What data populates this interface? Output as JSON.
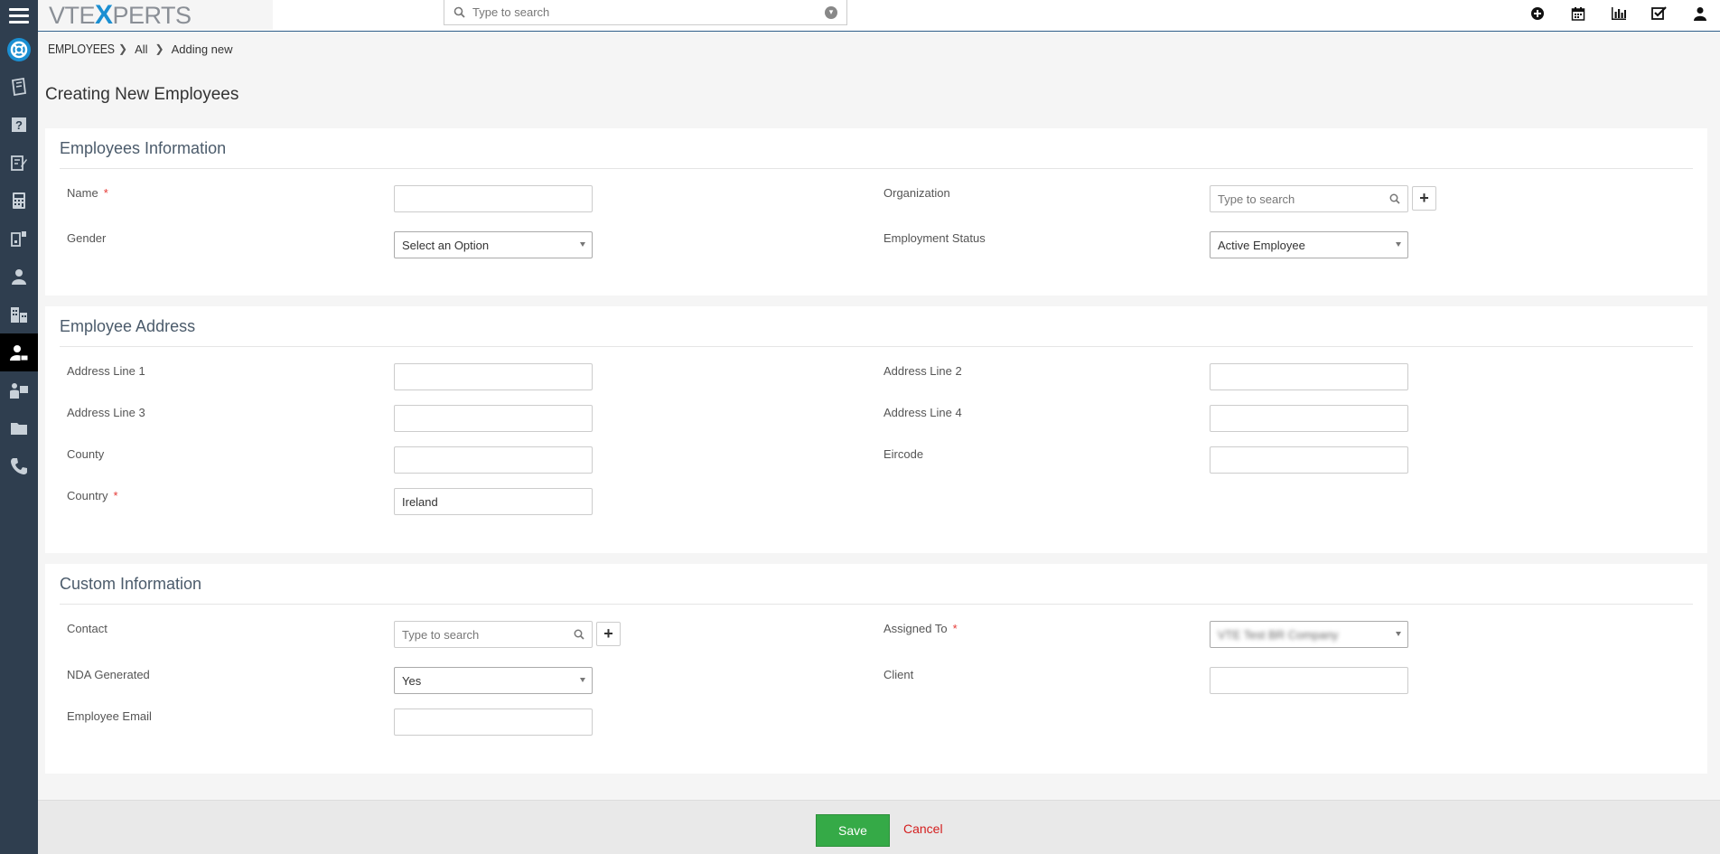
{
  "app": {
    "logo_pre": "VTE",
    "logo_x": "X",
    "logo_post": "PERTS"
  },
  "search": {
    "placeholder": "Type to search"
  },
  "top_icons": [
    "plus-circle-icon",
    "calendar-icon",
    "bar-chart-icon",
    "checkbox-icon",
    "user-icon"
  ],
  "sidebar": {
    "items": [
      "lifesaver-icon",
      "tickets-icon",
      "faq-icon",
      "edit-icon",
      "calculator-icon",
      "projects-icon",
      "contact-icon",
      "organizations-icon",
      "employees-icon",
      "vendors-icon",
      "documents-icon",
      "phone-icon"
    ],
    "active_index": 8
  },
  "breadcrumb": {
    "module": "EMPLOYEES",
    "level1": "All",
    "level2": "Adding new"
  },
  "page_title": "Creating New Employees",
  "blocks": {
    "info": {
      "title": "Employees Information",
      "name_label": "Name",
      "name_value": "",
      "organization_label": "Organization",
      "organization_placeholder": "Type to search",
      "gender_label": "Gender",
      "gender_value": "Select an Option",
      "employment_status_label": "Employment Status",
      "employment_status_value": "Active Employee"
    },
    "address": {
      "title": "Employee Address",
      "line1_label": "Address Line 1",
      "line2_label": "Address Line 2",
      "line3_label": "Address Line 3",
      "line4_label": "Address Line 4",
      "county_label": "County",
      "eircode_label": "Eircode",
      "country_label": "Country",
      "country_value": "Ireland"
    },
    "custom": {
      "title": "Custom Information",
      "contact_label": "Contact",
      "contact_placeholder": "Type to search",
      "assigned_to_label": "Assigned To",
      "assigned_to_value": "VTE Test BR Company",
      "nda_label": "NDA Generated",
      "nda_value": "Yes",
      "client_label": "Client",
      "employee_email_label": "Employee Email"
    }
  },
  "required_mark": "*",
  "footer": {
    "save_label": "Save",
    "cancel_label": "Cancel"
  }
}
